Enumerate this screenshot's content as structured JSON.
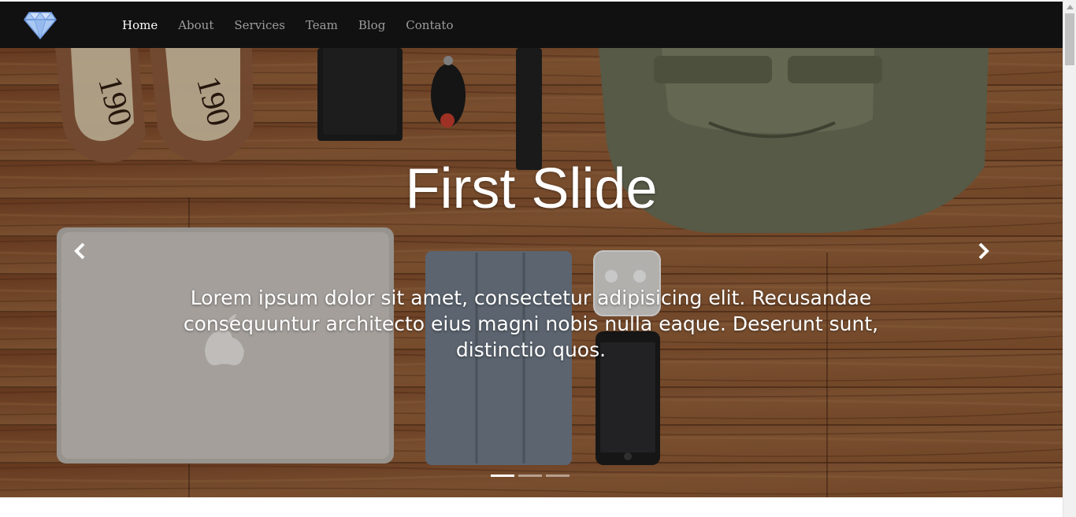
{
  "navbar": {
    "brand_icon": "diamond-icon",
    "links": [
      {
        "label": "Home",
        "active": true
      },
      {
        "label": "About",
        "active": false
      },
      {
        "label": "Services",
        "active": false
      },
      {
        "label": "Team",
        "active": false
      },
      {
        "label": "Blog",
        "active": false
      },
      {
        "label": "Contato",
        "active": false
      }
    ]
  },
  "carousel": {
    "title": "First Slide",
    "text": "Lorem ipsum dolor sit amet, consectetur adipisicing elit. Recusandae consequuntur architecto eius magni nobis nulla eaque. Deserunt sunt, distinctio quos.",
    "prev_icon": "chevron-left-icon",
    "next_icon": "chevron-right-icon",
    "slide_count": 3,
    "active_slide": 1
  },
  "colors": {
    "navbar_bg": "#111111",
    "nav_active": "#ffffff",
    "nav_inactive": "#9d9d9d",
    "wood": "#8a542f"
  }
}
